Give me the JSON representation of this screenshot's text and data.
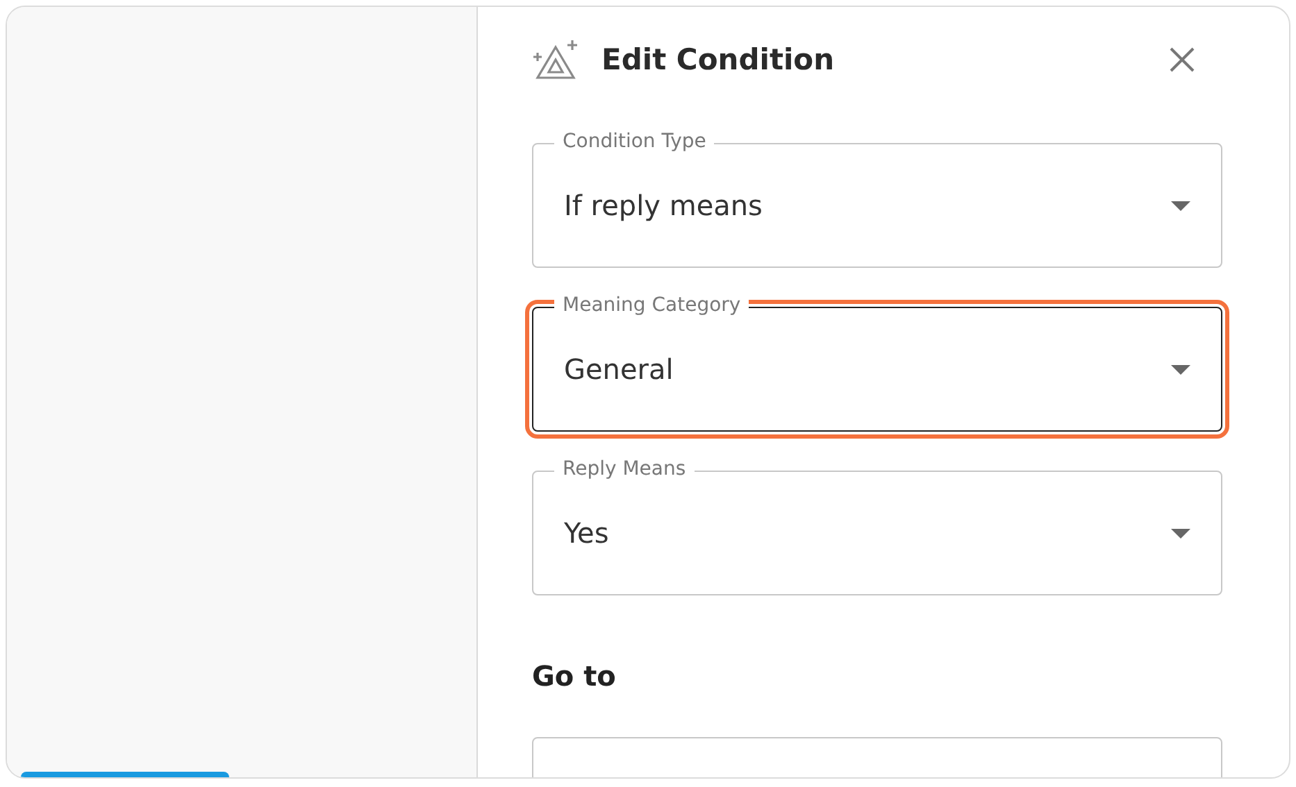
{
  "panel": {
    "title": "Edit Condition"
  },
  "fields": [
    {
      "label": "Condition Type",
      "value": "If reply means",
      "highlighted": false
    },
    {
      "label": "Meaning Category",
      "value": "General",
      "highlighted": true
    },
    {
      "label": "Reply Means",
      "value": "Yes",
      "highlighted": false
    }
  ],
  "goto": {
    "heading": "Go to"
  }
}
